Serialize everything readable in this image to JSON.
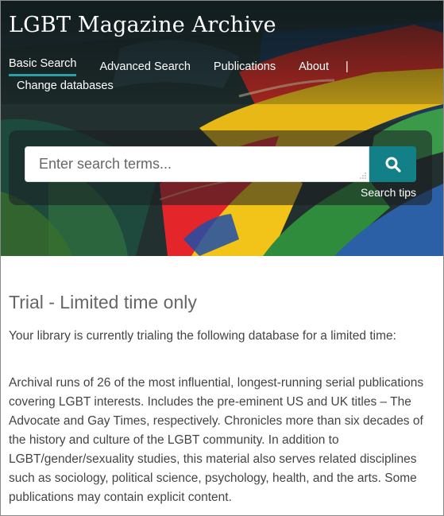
{
  "header": {
    "site_title": "LGBT Magazine Archive"
  },
  "nav": {
    "items": [
      {
        "label": "Basic Search",
        "active": true
      },
      {
        "label": "Advanced Search",
        "active": false
      },
      {
        "label": "Publications",
        "active": false
      },
      {
        "label": "About",
        "active": false
      }
    ],
    "separator": "|",
    "change_databases": "Change databases"
  },
  "search": {
    "placeholder": "Enter search terms...",
    "button_icon": "search-icon",
    "tips_label": "Search tips"
  },
  "trial": {
    "heading": "Trial - Limited time only",
    "intro": "Your library is currently trialing the following database for a limited time:",
    "description": "Archival runs of 26 of the most influential, longest-running serial publications covering LGBT interests. Includes the pre-eminent US and UK titles – The Advocate and Gay Times, respectively. Chronicles more than six decades of the history and culture of the LGBT community. In addition to LGBT/gender/sexuality studies, this material also serves related disciplines such as sociology, political science, psychology, health, and the arts. Some publications may contain explicit content."
  },
  "colors": {
    "accent": "#138087",
    "active_underline": "#2aa0a4"
  }
}
